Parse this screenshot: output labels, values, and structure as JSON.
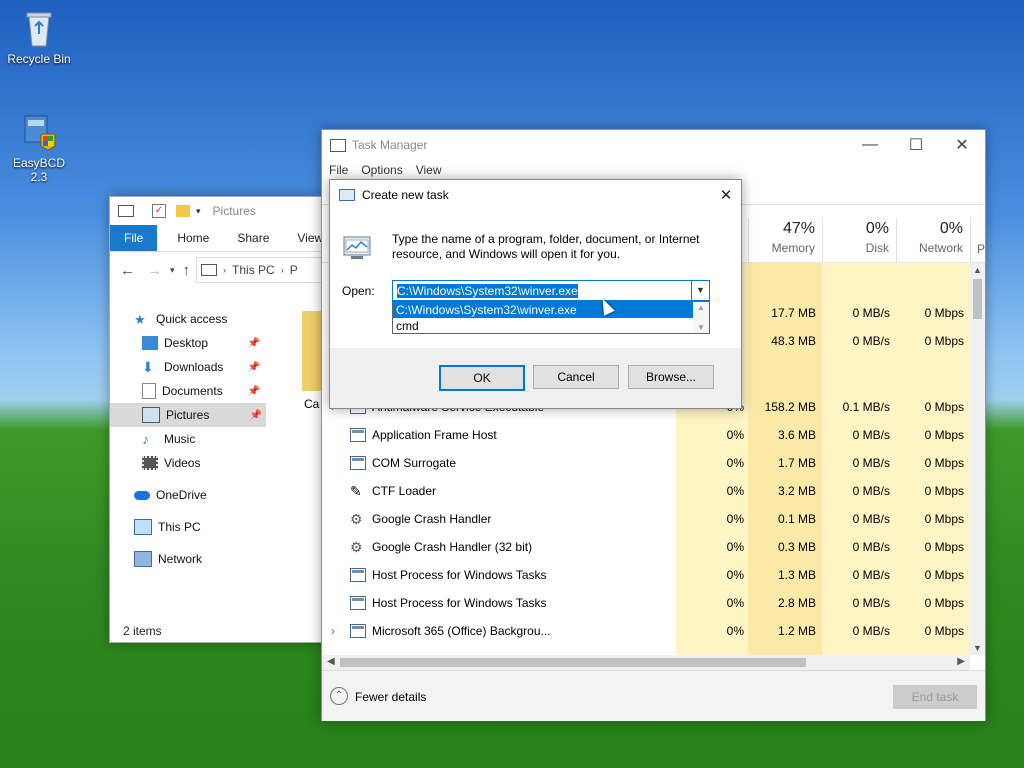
{
  "desktop": {
    "icons": [
      {
        "label": "Recycle Bin",
        "icon": "recycle-bin-icon"
      },
      {
        "label": "EasyBCD 2.3",
        "icon": "easybcd-icon"
      }
    ]
  },
  "explorer": {
    "title": "Pictures",
    "tabs": [
      "File",
      "Home",
      "Share",
      "View"
    ],
    "address": {
      "this_pc": "This PC",
      "trail": "P"
    },
    "nav": [
      {
        "label": "Quick access",
        "icon": "star-icon"
      },
      {
        "label": "Desktop",
        "icon": "desktop-folder-icon",
        "pinned": true
      },
      {
        "label": "Downloads",
        "icon": "download-arrow-icon",
        "pinned": true
      },
      {
        "label": "Documents",
        "icon": "documents-icon",
        "pinned": true
      },
      {
        "label": "Pictures",
        "icon": "pictures-icon",
        "pinned": true
      },
      {
        "label": "Music",
        "icon": "music-note-icon"
      },
      {
        "label": "Videos",
        "icon": "film-icon"
      },
      {
        "label": "OneDrive",
        "icon": "cloud-icon"
      },
      {
        "label": "This PC",
        "icon": "computer-icon"
      },
      {
        "label": "Network",
        "icon": "network-icon"
      }
    ],
    "folder_label_fragment": "Ca",
    "status": "2 items"
  },
  "taskmgr": {
    "title": "Task Manager",
    "menu": [
      "File",
      "Options",
      "View"
    ],
    "columns": {
      "memory": {
        "pct": "47%",
        "label": "Memory"
      },
      "disk": {
        "pct": "0%",
        "label": "Disk"
      },
      "network": {
        "pct": "0%",
        "label": "Network"
      },
      "power_fragment": "P"
    },
    "top_rows": [
      {
        "memory": "17.7 MB",
        "disk": "0 MB/s",
        "network": "0 Mbps"
      },
      {
        "memory": "48.3 MB",
        "disk": "0 MB/s",
        "network": "0 Mbps"
      }
    ],
    "rows": [
      {
        "name": "Antimalware Service Executable",
        "cpu": "0%",
        "memory": "158.2 MB",
        "disk": "0.1 MB/s",
        "network": "0 Mbps",
        "expand": true
      },
      {
        "name": "Application Frame Host",
        "cpu": "0%",
        "memory": "3.6 MB",
        "disk": "0 MB/s",
        "network": "0 Mbps"
      },
      {
        "name": "COM Surrogate",
        "cpu": "0%",
        "memory": "1.7 MB",
        "disk": "0 MB/s",
        "network": "0 Mbps"
      },
      {
        "name": "CTF Loader",
        "cpu": "0%",
        "memory": "3.2 MB",
        "disk": "0 MB/s",
        "network": "0 Mbps"
      },
      {
        "name": "Google Crash Handler",
        "cpu": "0%",
        "memory": "0.1 MB",
        "disk": "0 MB/s",
        "network": "0 Mbps"
      },
      {
        "name": "Google Crash Handler (32 bit)",
        "cpu": "0%",
        "memory": "0.3 MB",
        "disk": "0 MB/s",
        "network": "0 Mbps"
      },
      {
        "name": "Host Process for Windows Tasks",
        "cpu": "0%",
        "memory": "1.3 MB",
        "disk": "0 MB/s",
        "network": "0 Mbps"
      },
      {
        "name": "Host Process for Windows Tasks",
        "cpu": "0%",
        "memory": "2.8 MB",
        "disk": "0 MB/s",
        "network": "0 Mbps"
      },
      {
        "name": "Microsoft 365 (Office) Backgrou...",
        "cpu": "0%",
        "memory": "1.2 MB",
        "disk": "0 MB/s",
        "network": "0 Mbps",
        "expand": true
      }
    ],
    "fewer_details": "Fewer details",
    "end_task": "End task"
  },
  "dialog": {
    "title": "Create new task",
    "description": "Type the name of a program, folder, document, or Internet resource, and Windows will open it for you.",
    "open_label": "Open:",
    "open_value": "C:\\Windows\\System32\\winver.exe",
    "dropdown_options": [
      "C:\\Windows\\System32\\winver.exe",
      "cmd"
    ],
    "ok": "OK",
    "cancel": "Cancel",
    "browse": "Browse..."
  },
  "colors": {
    "accent": "#0078d7",
    "file_tab": "#1979ca",
    "heat": "#fff4c4",
    "heat_strong": "#fbe9a8"
  }
}
